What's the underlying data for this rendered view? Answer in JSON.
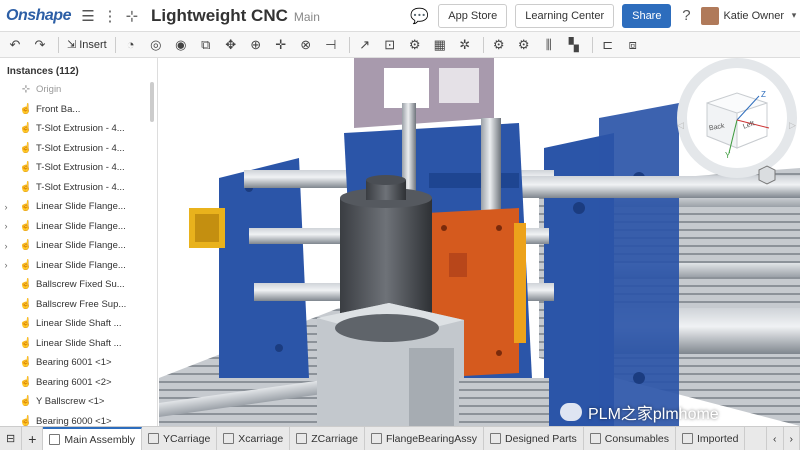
{
  "header": {
    "logo": "Onshape",
    "title": "Lightweight CNC",
    "branch": "Main",
    "app_store": "App Store",
    "learning_center": "Learning Center",
    "share": "Share",
    "user_name": "Katie Owner"
  },
  "toolbar": {
    "insert_label": "Insert"
  },
  "sidebar": {
    "heading": "Instances (112)",
    "items": [
      {
        "label": "Origin",
        "muted": true,
        "caret": false
      },
      {
        "label": "Front Ba...",
        "caret": false
      },
      {
        "label": "T-Slot Extrusion - 4...",
        "caret": false
      },
      {
        "label": "T-Slot Extrusion - 4...",
        "caret": false
      },
      {
        "label": "T-Slot Extrusion - 4...",
        "caret": false
      },
      {
        "label": "T-Slot Extrusion - 4...",
        "caret": false
      },
      {
        "label": "Linear Slide Flange...",
        "caret": true
      },
      {
        "label": "Linear Slide Flange...",
        "caret": true
      },
      {
        "label": "Linear Slide Flange...",
        "caret": true
      },
      {
        "label": "Linear Slide Flange...",
        "caret": true
      },
      {
        "label": "Ballscrew Fixed Su...",
        "caret": false
      },
      {
        "label": "Ballscrew Free Sup...",
        "caret": false
      },
      {
        "label": "Linear Slide Shaft ...",
        "caret": false
      },
      {
        "label": "Linear Slide Shaft ...",
        "caret": false
      },
      {
        "label": "Bearing 6001 <1>",
        "caret": false
      },
      {
        "label": "Bearing 6001 <2>",
        "caret": false
      },
      {
        "label": "Y Ballscrew <1>",
        "caret": false
      },
      {
        "label": "Bearing 6000 <1>",
        "caret": false
      }
    ]
  },
  "viewcube": {
    "front": "Back",
    "side": "Left",
    "axis_z": "Z",
    "axis_y": "Y"
  },
  "tabs": [
    {
      "label": "Main Assembly",
      "active": true
    },
    {
      "label": "YCarriage"
    },
    {
      "label": "Xcarriage"
    },
    {
      "label": "ZCarriage"
    },
    {
      "label": "FlangeBearingAssy"
    },
    {
      "label": "Designed Parts"
    },
    {
      "label": "Consumables"
    },
    {
      "label": "Imported"
    }
  ],
  "watermark": "PLM之家plmhome",
  "colors": {
    "brand": "#2d5fa6",
    "share_button": "#2d6dbd",
    "frame_blue": "#2b55a8",
    "plate_orange": "#d55a1e"
  }
}
